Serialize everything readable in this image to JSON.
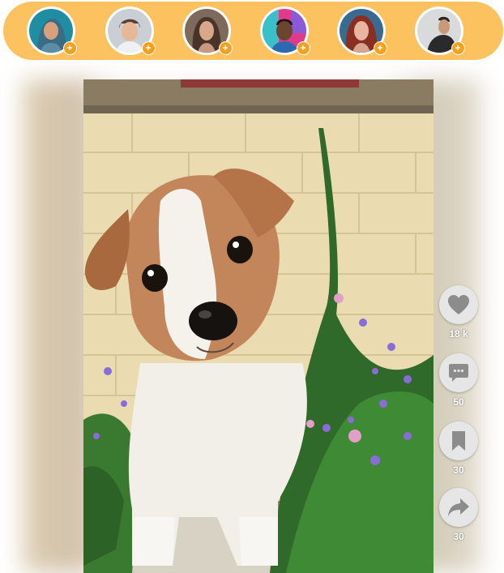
{
  "stories": [
    {
      "name": "story-1",
      "skin": "#d9a07e",
      "hair": "#3b6c86",
      "bg": "#1f8ea3"
    },
    {
      "name": "story-2",
      "skin": "#e6b898",
      "hair": "#5a4030",
      "bg": "#c9cfd4"
    },
    {
      "name": "story-3",
      "skin": "#d9a88a",
      "hair": "#4a3428",
      "bg": "#7c6a5c"
    },
    {
      "name": "story-4",
      "skin": "#6b4530",
      "hair": "#1e1512",
      "bg": "#e03a8a"
    },
    {
      "name": "story-5",
      "skin": "#e8b5a0",
      "hair": "#8a2e22",
      "bg": "#3a6a90"
    },
    {
      "name": "story-6",
      "skin": "#c99a7a",
      "hair": "#2a2522",
      "bg": "#d9dadb"
    }
  ],
  "actions": {
    "like": {
      "icon": "heart-icon",
      "count": "18 k"
    },
    "comment": {
      "icon": "comment-icon",
      "count": "50"
    },
    "save": {
      "icon": "bookmark-icon",
      "count": "30"
    },
    "share": {
      "icon": "share-icon",
      "count": "30"
    }
  },
  "colors": {
    "stories_bar": "#fbc25f",
    "badge": "#f6a020",
    "action_bg": "#e6e6e6",
    "action_icon": "#8c8c8c"
  }
}
